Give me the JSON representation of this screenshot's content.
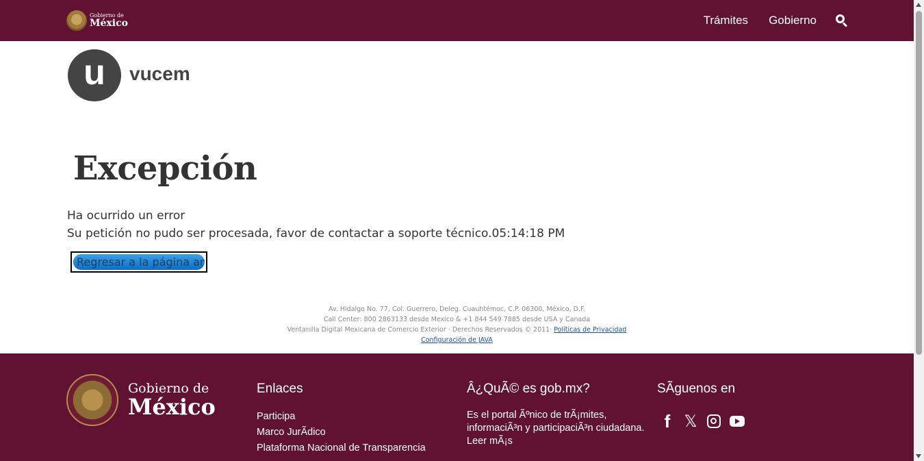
{
  "header": {
    "brand_small": "Gobierno de",
    "brand_large": "México",
    "nav": [
      "Trámites",
      "Gobierno"
    ],
    "search_icon": "search-icon"
  },
  "logo": {
    "mark": "u",
    "word": "vucem"
  },
  "main": {
    "title": "Excepción",
    "line1": "Ha ocurrido un error",
    "line2": "Su petición no pudo ser procesada, favor de contactar a soporte técnico.05:14:18 PM",
    "back_button": "Regresar a la página anterior"
  },
  "small_footer": {
    "address": "Av. Hidalgo No. 77, Col. Guerrero, Deleg. Cuauhtémoc, C.P. 06300, México, D.F.",
    "callcenter": "Call Center: 800 2863133 desde Mexico & +1 844 549 7885 desde USA y Canada",
    "rights": "Ventanilla Digital Mexicana de Comercio Exterior · Derechos Reservados © 2011·",
    "privacy_link": "Políticas de Privacidad",
    "java_link": "Configuración de JAVA"
  },
  "footer": {
    "brand_line1": "Gobierno de",
    "brand_line2": "México",
    "links_title": "Enlaces",
    "links": [
      "Participa",
      "Marco JurÃdico",
      "Plataforma Nacional de Transparencia"
    ],
    "about_title": "Â¿QuÃ© es gob.mx?",
    "about_text": "Es el portal Ãºnico de trÃ¡mites, informaciÃ³n y participaciÃ³n ciudadana. Leer mÃ¡s",
    "follow_title": "SÃguenos en",
    "socials": [
      "facebook-icon",
      "x-icon",
      "instagram-icon",
      "youtube-icon"
    ]
  },
  "colors": {
    "brand": "#611232",
    "logo_gray": "#444444"
  }
}
